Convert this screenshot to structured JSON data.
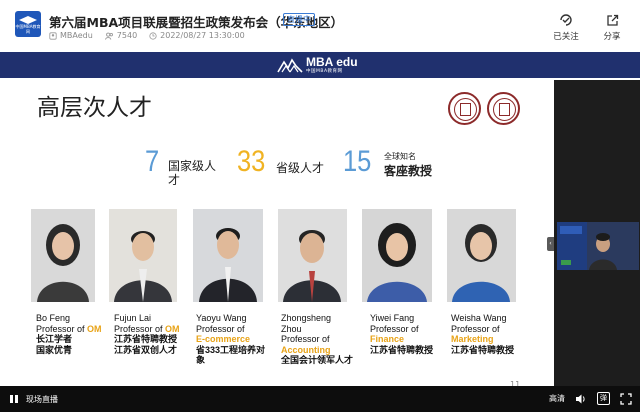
{
  "header": {
    "title": "第六届MBA项目联展暨招生政策发布会（华东地区）",
    "live_badge": "直播中",
    "logo_text": "中国MBA教育网",
    "meta": {
      "author": "MBAedu",
      "views": "7540",
      "datetime": "2022/08/27 13:30:00"
    },
    "actions": {
      "follow_label": "已关注",
      "share_label": "分享"
    }
  },
  "slide": {
    "banner": {
      "brand": "MBA edu",
      "tagline": "中国MBA教育网"
    },
    "title": "高层次人才",
    "stats": [
      {
        "number": "7",
        "label_line1": "国家级人",
        "label_line2": "才",
        "color": "#5b9bd5"
      },
      {
        "number": "33",
        "label": "省级人才",
        "color": "#f0b323"
      },
      {
        "number": "15",
        "label_small": "全球知名",
        "label_bold": "客座教授",
        "color": "#5b9bd5"
      }
    ],
    "people": [
      {
        "en": [
          "Bo Feng",
          "Professor of "
        ],
        "field": "OM",
        "cn": [
          "长江学者",
          "国家优青"
        ]
      },
      {
        "en": [
          "Fujun Lai",
          "Professor of "
        ],
        "field": "OM",
        "cn": [
          "江苏省特聘教授",
          "江苏省双创人才"
        ]
      },
      {
        "en": [
          "Yaoyu Wang",
          "Professor of"
        ],
        "field": "E-commerce",
        "cn": [
          "省333工程培养对",
          "象"
        ]
      },
      {
        "en": [
          "Zhongsheng",
          "Zhou",
          "Professor of"
        ],
        "field": "Accounting",
        "cn": [
          "全国会计领军人才"
        ]
      },
      {
        "en": [
          "Yiwei Fang",
          "Professor of"
        ],
        "field": "Finance",
        "cn": [
          "江苏省特聘教授"
        ]
      },
      {
        "en": [
          "Weisha Wang",
          "Professor of"
        ],
        "field": "Marketing",
        "cn": [
          "江苏省特聘教授"
        ]
      }
    ],
    "page_number": "11",
    "accent_color": "#e8a317"
  },
  "sidebar": {
    "collapse_icon": "‹"
  },
  "controls": {
    "live_label": "现场直播",
    "quality_label": "高清",
    "danmu_label": "弹"
  }
}
